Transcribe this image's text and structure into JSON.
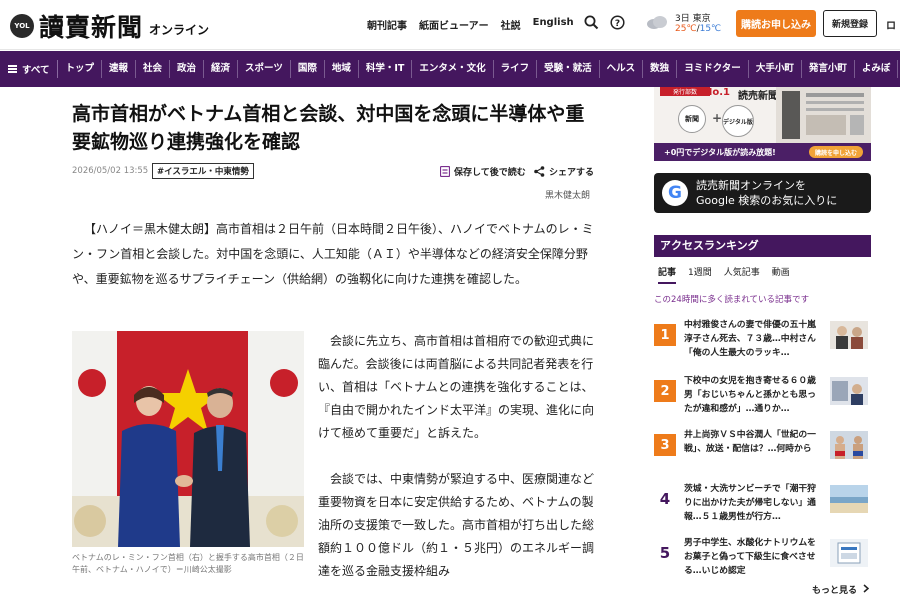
{
  "header": {
    "logo_badge": "YOL",
    "logo_main": "讀賣新聞",
    "logo_sub": "オンライン",
    "nav": [
      "朝刊記事",
      "紙面ビューアー",
      "社説",
      "English"
    ],
    "weather_city": "3日 東京",
    "weather_high": "25℃",
    "weather_low": "15℃",
    "subscribe_label": "購読お申し込み",
    "register_label": "新規登録",
    "login_label": "ロ"
  },
  "nav": {
    "all_label": "すべて",
    "items": [
      "トップ",
      "速報",
      "社会",
      "政治",
      "経済",
      "スポーツ",
      "国際",
      "地域",
      "科学・IT",
      "エンタメ・文化",
      "ライフ",
      "受験・就活",
      "ヘルス",
      "数独",
      "ヨミドクター",
      "大手小町",
      "発言小町",
      "よみぼ"
    ]
  },
  "article": {
    "headline": "高市首相がベトナム首相と会談、対中国を念頭に半導体や重要鉱物巡り連携強化を確認",
    "date": "2026/05/02 13:55",
    "tag": "#イスラエル・中東情勢",
    "save_label": "保存して後で読む",
    "share_label": "シェアする",
    "byline": "黒木健太朗",
    "lead": "【ハノイ＝黒木健太朗】高市首相は２日午前（日本時間２日午後）、ハノイでベトナムのレ・ミン・フン首相と会談した。対中国を念頭に、人工知能（ＡＩ）や半導体などの経済安全保障分野や、重要鉱物を巡るサプライチェーン（供給網）の強靱化に向けた連携を確認した。",
    "paragraphs": [
      "会談に先立ち、高市首相は首相府での歓迎式典に臨んだ。会談後には両首脳による共同記者発表を行い、首相は「ベトナムとの連携を強化することは、『自由で開かれたインド太平洋』の実現、進化に向けて極めて重要だ」と訴えた。",
      "会談では、中東情勢が緊迫する中、医療関連など重要物資を日本に安定供給するため、ベトナムの製油所の支援策で一致した。高市首相が打ち出した総額約１００億ドル（約１・５兆円）のエネルギー調達を巡る金融支援枠組み"
    ],
    "caption": "ベトナムのレ・ミン・フン首相（右）と握手する高市首相（２日午前、ベトナム・ハノイで）＝川崎公太撮影"
  },
  "sidebar": {
    "ad1_top": "発行部数",
    "ad1_no1": "No.1",
    "ad1_brand": "読売新聞",
    "ad1_circle1": "新聞",
    "ad1_circle2": "デジタル版",
    "ad1_strip": "+0円でデジタル版が読み放題!",
    "ad1_apply": "購読を申し込む",
    "gbanner_line1": "読売新聞オンラインを",
    "gbanner_line2": "Google 検索のお気に入りに",
    "ranking_title": "アクセスランキング",
    "ranking_tabs": [
      "記事",
      "1週間",
      "人気記事",
      "動画"
    ],
    "ranking_note": "この24時間に多く読まれている記事です",
    "items": [
      {
        "rank": "1",
        "text": "中村雅俊さんの妻で俳優の五十嵐淳子さん死去、７３歳…中村さん「俺の人生最大のラッキ…"
      },
      {
        "rank": "2",
        "text": "下校中の女児を抱き寄せる６０歳男「おじいちゃんと孫かとも思ったが違和感が」…通りか…"
      },
      {
        "rank": "3",
        "text": "井上尚弥ＶＳ中谷潤人「世紀の一戦」、放送・配信は？…何時から"
      },
      {
        "rank": "4",
        "text": "茨城・大洗サンビーチで「潮干狩りに出かけた夫が帰宅しない」通報…５１歳男性が行方…"
      },
      {
        "rank": "5",
        "text": "男子中学生、水酸化ナトリウムをお菓子と偽って下級生に食べさせる…いじめ認定"
      }
    ],
    "more_label": "もっと見る"
  }
}
